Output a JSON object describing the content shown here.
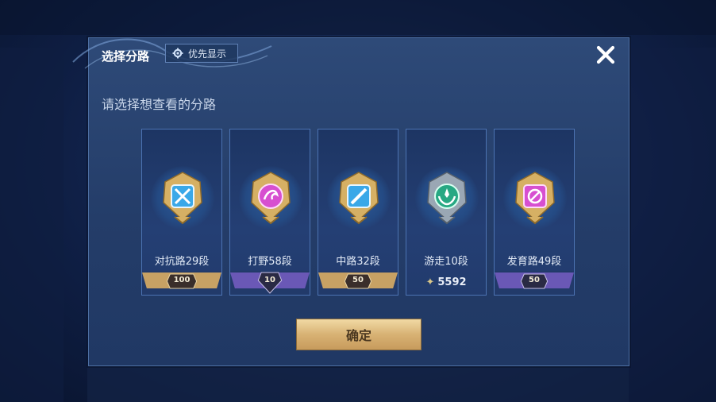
{
  "dialog": {
    "title": "选择分路",
    "priority_label": "优先显示",
    "prompt": "请选择想查看的分路",
    "confirm_label": "确定",
    "colors": {
      "panel": "#2b4674",
      "gold": "#d8b274",
      "purple": "#6b58b8"
    }
  },
  "lanes": [
    {
      "name": "对抗路29段",
      "rank": "100",
      "bar": "gold",
      "icon": "clash-lane-icon",
      "emblem_color": "#4fb9f0"
    },
    {
      "name": "打野58段",
      "rank": "10",
      "bar": "purple",
      "icon": "jungle-dragon-icon",
      "emblem_color": "#e061d6"
    },
    {
      "name": "中路32段",
      "rank": "50",
      "bar": "gold",
      "icon": "mid-lane-icon",
      "emblem_color": "#4fb9f0"
    },
    {
      "name": "游走10段",
      "points": "5592",
      "bar": "none",
      "icon": "roam-icon",
      "emblem_color": "#2fb58c"
    },
    {
      "name": "发育路49段",
      "rank": "50",
      "bar": "purple",
      "icon": "farm-lane-icon",
      "emblem_color": "#e061d6"
    }
  ]
}
